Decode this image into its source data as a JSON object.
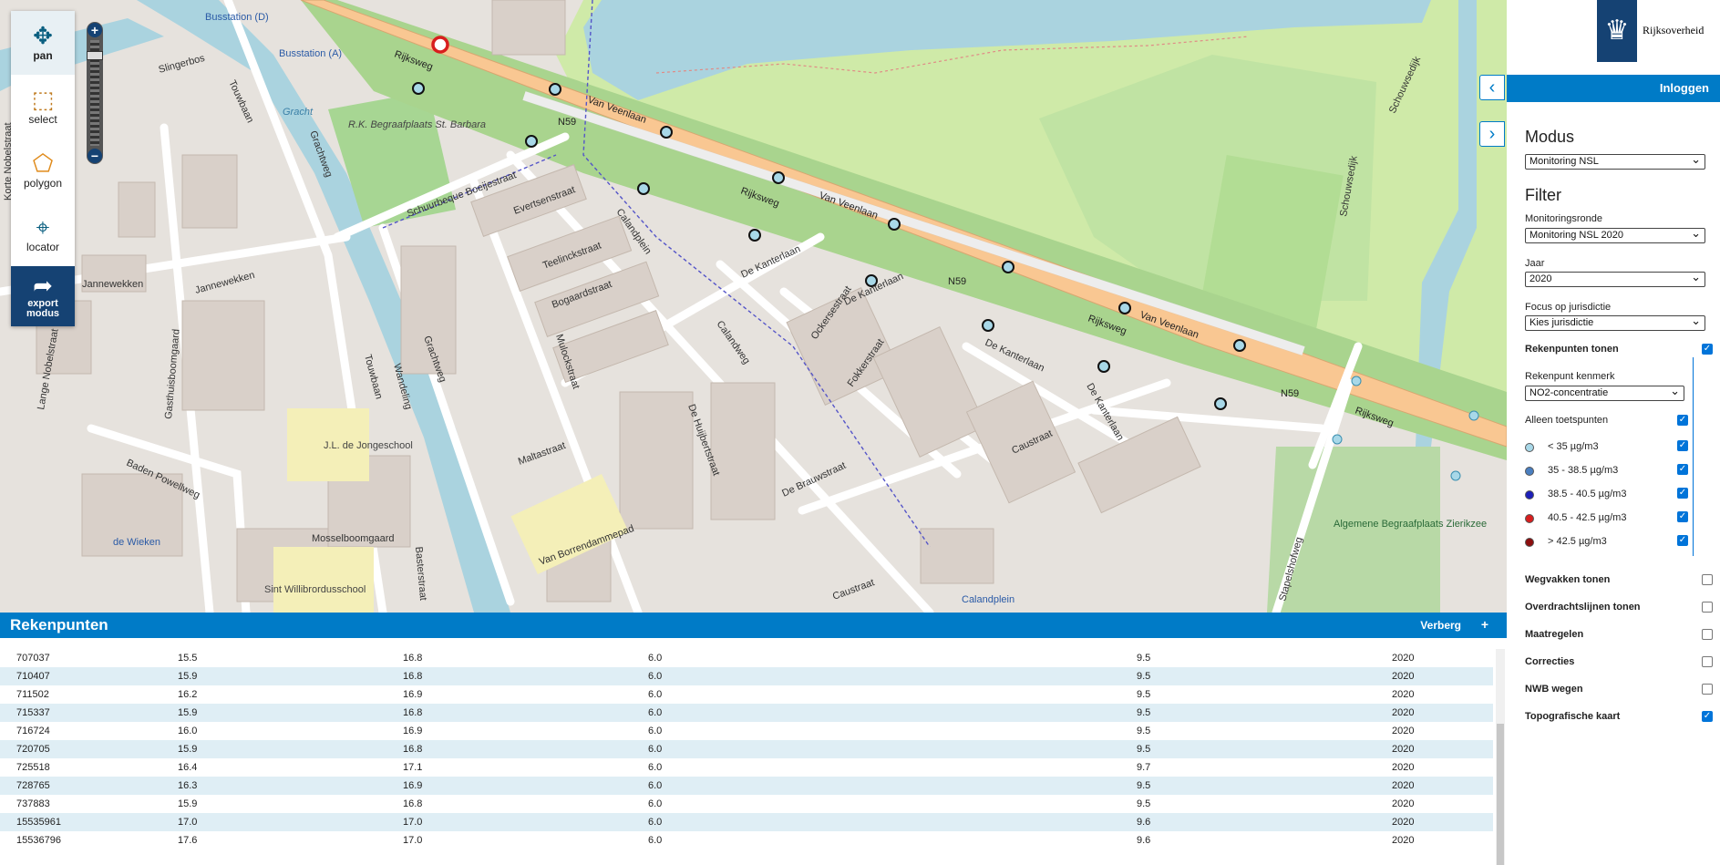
{
  "map": {
    "street_labels": [
      "Rijksweg",
      "Van Veenlaan",
      "Rijksweg",
      "Van Veenlaan",
      "Van Veenlaan",
      "Rijksweg",
      "Rijksweg",
      "N59",
      "N59",
      "N59",
      "Schuurbeque Boeijestraat",
      "Evertsenstraat",
      "Teelinckstraat",
      "Bogaardstraat",
      "Calandplein",
      "Calandweg",
      "De Kanterlaan",
      "De Kanterlaan",
      "De Kanterlaan",
      "De Kanterlaan",
      "Grachtweg",
      "Grachtweg",
      "Jannewekken",
      "Jannewekken",
      "Touwbaan",
      "Touwbaan",
      "Gasthuisboomgaard",
      "Mulockstraat",
      "Maltastraat",
      "De Huijbertstraat",
      "Caustraat",
      "Caustraat",
      "Baden Powellweg",
      "Mosselboomgaard",
      "Slingerbos",
      "Schouwsedijk",
      "Schouwsedijk",
      "Stapelshofweg",
      "De Brauwstraat",
      "Fokkerstraat",
      "Ockersestraat",
      "Van Borrendammepad",
      "Wandeling",
      "Basterstraat",
      "Lange Nobelstraat",
      "Korte Nobelstraat"
    ],
    "place_labels": [
      "Busstation (D)",
      "Busstation (A)",
      "R.K. Begraafplaats St. Barbara",
      "J.L. de Jongeschool",
      "de Wieken",
      "Sint Willibrordusschool",
      "Algemene Begraafplaats Zierikzee",
      "Calandplein",
      "Gracht"
    ]
  },
  "toolbar": {
    "tools": [
      {
        "label": "pan",
        "icon": "move-icon"
      },
      {
        "label": "select",
        "icon": "select-icon"
      },
      {
        "label": "polygon",
        "icon": "polygon-icon"
      },
      {
        "label": "locator",
        "icon": "crosshair-icon"
      }
    ],
    "export_label_1": "export",
    "export_label_2": "modus",
    "zoom_in": "+",
    "zoom_out": "−"
  },
  "sidebar": {
    "brand": "Rijksoverheid",
    "login": "Inloggen",
    "modus_title": "Modus",
    "modus_value": "Monitoring NSL",
    "filter_title": "Filter",
    "monitoringsronde_label": "Monitoringsronde",
    "monitoringsronde_value": "Monitoring NSL 2020",
    "jaar_label": "Jaar",
    "jaar_value": "2020",
    "focus_label": "Focus op jurisdictie",
    "focus_value": "Kies jurisdictie",
    "rekenpunten_tonen": "Rekenpunten tonen",
    "kenmerk_label": "Rekenpunt kenmerk",
    "kenmerk_value": "NO2-concentratie",
    "alleen_toetspunten": "Alleen toetspunten",
    "legend": [
      {
        "label": "< 35 µg/m3",
        "color": "#a8d8e8"
      },
      {
        "label": "35 - 38.5 µg/m3",
        "color": "#4a7fc0"
      },
      {
        "label": "38.5 - 40.5 µg/m3",
        "color": "#1d1fb8"
      },
      {
        "label": "40.5 - 42.5 µg/m3",
        "color": "#d81e1e"
      },
      {
        "label": "> 42.5 µg/m3",
        "color": "#8c0e0e"
      }
    ],
    "layers": [
      {
        "label": "Wegvakken tonen",
        "checked": false
      },
      {
        "label": "Overdrachtslijnen tonen",
        "checked": false
      },
      {
        "label": "Maatregelen",
        "checked": false
      },
      {
        "label": "Correcties",
        "checked": false
      },
      {
        "label": "NWB wegen",
        "checked": false
      },
      {
        "label": "Topografische kaart",
        "checked": true
      }
    ]
  },
  "table": {
    "title": "Rekenpunten",
    "hide": "Verberg",
    "add": "+",
    "rows": [
      [
        "707037",
        "15.5",
        "16.8",
        "6.0",
        "9.5",
        "2020"
      ],
      [
        "710407",
        "15.9",
        "16.8",
        "6.0",
        "9.5",
        "2020"
      ],
      [
        "711502",
        "16.2",
        "16.9",
        "6.0",
        "9.5",
        "2020"
      ],
      [
        "715337",
        "15.9",
        "16.8",
        "6.0",
        "9.5",
        "2020"
      ],
      [
        "716724",
        "16.0",
        "16.9",
        "6.0",
        "9.5",
        "2020"
      ],
      [
        "720705",
        "15.9",
        "16.8",
        "6.0",
        "9.5",
        "2020"
      ],
      [
        "725518",
        "16.4",
        "17.1",
        "6.0",
        "9.7",
        "2020"
      ],
      [
        "728765",
        "16.3",
        "16.9",
        "6.0",
        "9.5",
        "2020"
      ],
      [
        "737883",
        "15.9",
        "16.8",
        "6.0",
        "9.5",
        "2020"
      ],
      [
        "15535961",
        "17.0",
        "17.0",
        "6.0",
        "9.6",
        "2020"
      ],
      [
        "15536796",
        "17.6",
        "17.0",
        "6.0",
        "9.6",
        "2020"
      ]
    ]
  }
}
